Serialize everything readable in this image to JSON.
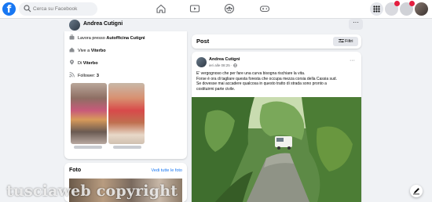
{
  "search": {
    "placeholder": "Cerca su Facebook"
  },
  "profile": {
    "name": "Andrea Cutigni",
    "more": "···"
  },
  "intro": {
    "work_prefix": "Lavora presso ",
    "work_place": "Autofficina Cutigni",
    "lives_prefix": "Vive a ",
    "lives_place": "Viterbo",
    "from_prefix": "Di ",
    "from_place": "Viterbo",
    "followers_prefix": "Follower: ",
    "followers_count": "3"
  },
  "photos": {
    "title": "Foto",
    "link": "Vedi tutte le foto"
  },
  "posts": {
    "title": "Post",
    "filter_label": "Filtri"
  },
  "post": {
    "author": "Andrea Cutigni",
    "time": "ieri alle 08:25 · ",
    "more": "···",
    "lines": [
      "E' vergognoso che per fare una curva bisogna rischiare la vita.",
      "Forse è  ora di tagliare questa foresta che occupa mezza corsia della Cassia sud.",
      "Se dovesse mai accadere qualcosa in questo tratto di strada sono pronto a",
      "costituirmi parte civile."
    ]
  },
  "watermark": "tusciaweb copyright",
  "colors": {
    "brand": "#1877f2",
    "background": "#f0f2f5",
    "card": "#ffffff"
  }
}
